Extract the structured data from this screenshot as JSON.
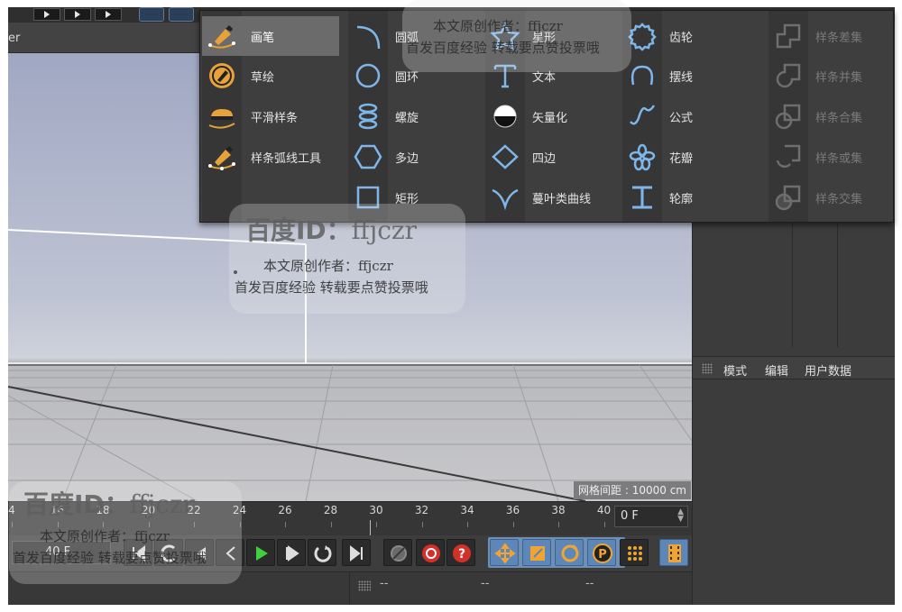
{
  "viewport": {
    "header_label": "er",
    "grid_readout": "网格间距 : 10000 cm"
  },
  "spline_menu": {
    "col1": [
      {
        "label": "画笔",
        "icon": "pen-icon",
        "selected": true
      },
      {
        "label": "草绘",
        "icon": "sketch-icon"
      },
      {
        "label": "平滑样条",
        "icon": "smooth-spline-icon"
      },
      {
        "label": "样条弧线工具",
        "icon": "spline-arc-tool-icon"
      }
    ],
    "col2": [
      {
        "label": "圆弧",
        "icon": "arc-icon"
      },
      {
        "label": "圆环",
        "icon": "circle-icon"
      },
      {
        "label": "螺旋",
        "icon": "helix-icon"
      },
      {
        "label": "多边",
        "icon": "hexagon-icon"
      },
      {
        "label": "矩形",
        "icon": "rectangle-icon"
      }
    ],
    "col3": [
      {
        "label": "星形",
        "icon": "star-icon"
      },
      {
        "label": "文本",
        "icon": "text-icon"
      },
      {
        "label": "矢量化",
        "icon": "vectorize-icon"
      },
      {
        "label": "四边",
        "icon": "diamond-icon"
      },
      {
        "label": "蔓叶类曲线",
        "icon": "cissoid-icon"
      }
    ],
    "col4": [
      {
        "label": "齿轮",
        "icon": "gear-icon"
      },
      {
        "label": "摆线",
        "icon": "cycloid-icon"
      },
      {
        "label": "公式",
        "icon": "formula-icon"
      },
      {
        "label": "花瓣",
        "icon": "flower-icon"
      },
      {
        "label": "轮廓",
        "icon": "profile-icon"
      }
    ],
    "col5": [
      {
        "label": "样条差集",
        "icon": "spline-subtract-icon",
        "disabled": true
      },
      {
        "label": "样条并集",
        "icon": "spline-union-icon",
        "disabled": true
      },
      {
        "label": "样条合集",
        "icon": "spline-and-icon",
        "disabled": true
      },
      {
        "label": "样条或集",
        "icon": "spline-or-icon",
        "disabled": true
      },
      {
        "label": "样条交集",
        "icon": "spline-intersect-icon",
        "disabled": true
      }
    ]
  },
  "attributes": {
    "menu": [
      "模式",
      "编辑",
      "用户数据"
    ]
  },
  "timeline": {
    "ticks": [
      "4",
      "16",
      "18",
      "20",
      "22",
      "24",
      "26",
      "28",
      "30",
      "32",
      "34",
      "36",
      "38",
      "40"
    ],
    "current_frame": "0 F"
  },
  "transport": {
    "fps": "40 F"
  },
  "bottom": {
    "dashes": [
      "--",
      "--",
      "--"
    ]
  },
  "watermark": {
    "brand": "百度ID：",
    "handle": "ffjczr",
    "line1": "本文原创作者：ffjczr",
    "line2": "首发百度经验  转载要点赞投票哦"
  },
  "colors": {
    "accent_orange": "#e8a23a",
    "accent_blue": "#7fb6ea",
    "selection_blue": "#5d87b8",
    "record_red": "#d3302a"
  }
}
